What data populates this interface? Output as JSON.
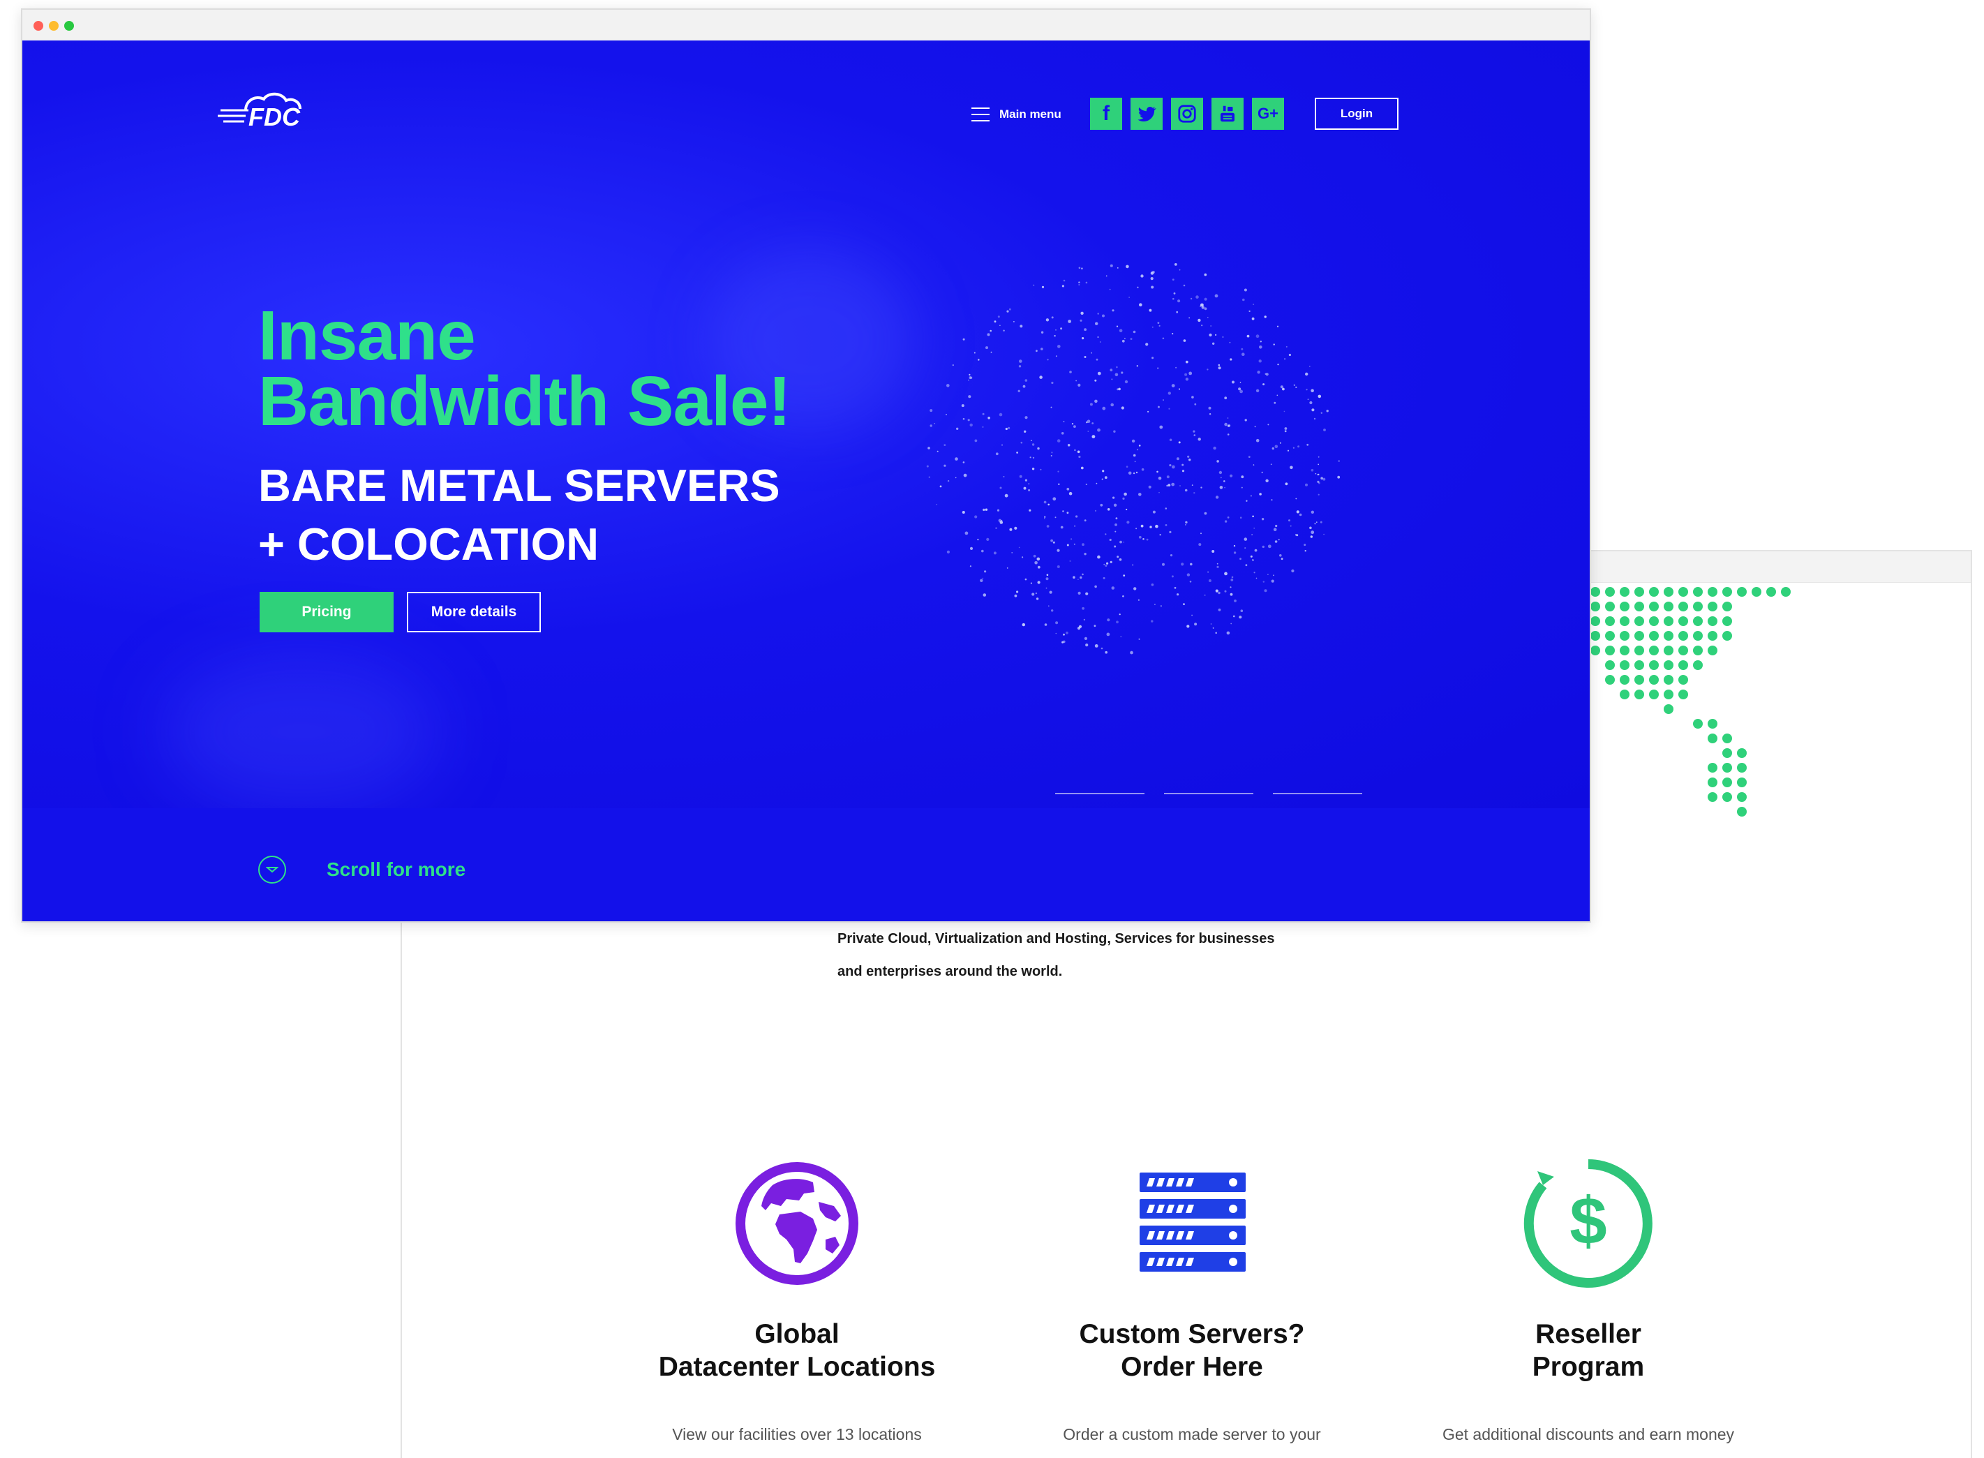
{
  "header": {
    "logo_text": "FDC",
    "main_menu_label": "Main menu",
    "social": {
      "facebook": "f",
      "twitter": "twitter-icon",
      "instagram": "instagram-icon",
      "youtube": "youtube-icon",
      "googleplus": "G+"
    },
    "login_label": "Login"
  },
  "hero": {
    "title_line1": "Insane",
    "title_line2": "Bandwidth Sale!",
    "subtitle_line1": "BARE METAL SERVERS",
    "subtitle_line2": "+ COLOCATION",
    "pricing_label": "Pricing",
    "more_details_label": "More details",
    "scroll_label": "Scroll for more"
  },
  "intro": {
    "line1": "Private Cloud, Virtualization and Hosting, Services for businesses",
    "line2": "and enterprises around the world."
  },
  "features": [
    {
      "icon": "globe-icon",
      "title_line1": "Global",
      "title_line2": "Datacenter Locations",
      "desc": "View our facilities over 13 locations"
    },
    {
      "icon": "server-stack-icon",
      "title_line1": "Custom Servers?",
      "title_line2": "Order Here",
      "desc": "Order a custom made server to your"
    },
    {
      "icon": "dollar-icon",
      "title_line1": "Reseller",
      "title_line2": "Program",
      "desc": "Get additional discounts and earn money"
    }
  ],
  "colors": {
    "brand_blue": "#1311ea",
    "accent_green": "#2fd17a",
    "purple": "#7a1fe0",
    "server_blue": "#1f3fe6"
  }
}
